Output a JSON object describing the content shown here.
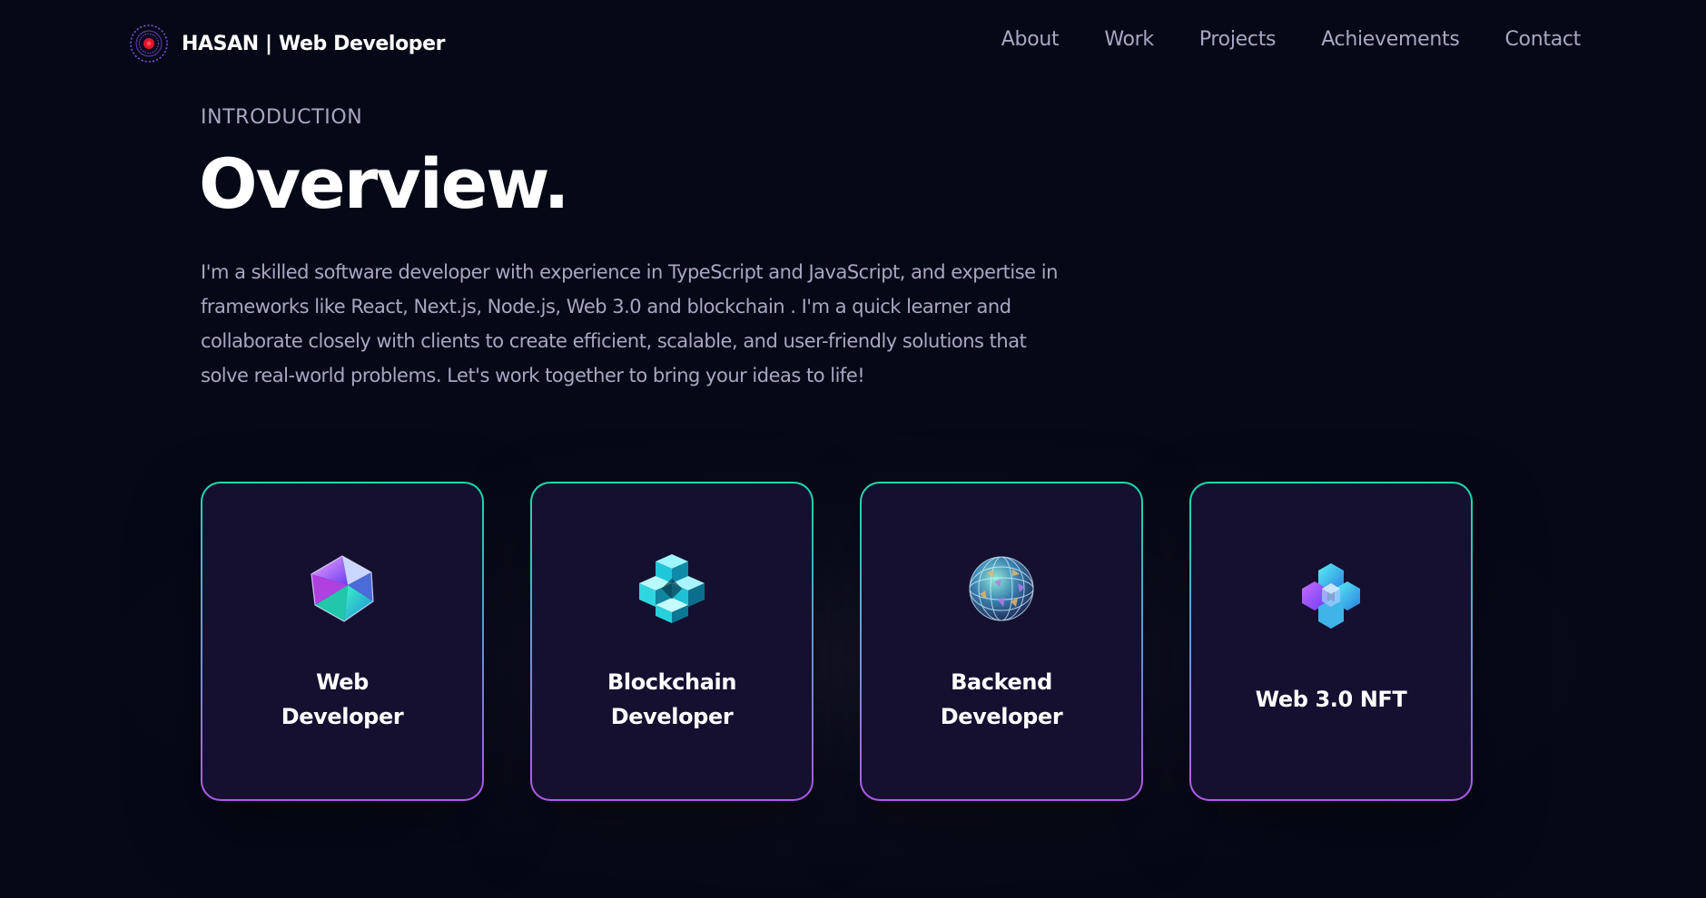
{
  "navbar": {
    "brand": "HASAN  | Web Developer",
    "links": [
      "About",
      "Work",
      "Projects",
      "Achievements",
      "Contact"
    ]
  },
  "intro": {
    "subtitle": "Introduction",
    "title": "Overview.",
    "paragraph": "I'm a skilled software developer with experience in TypeScript and JavaScript, and expertise in frameworks like React, Next.js, Node.js, Web 3.0 and blockchain . I'm a quick learner and collaborate closely with clients to create efficient, scalable, and user-friendly solutions that solve real-world problems. Let's work together to bring your ideas to life!"
  },
  "services": [
    {
      "title": "Web Developer",
      "icon": "icosahedron-gem-icon"
    },
    {
      "title": "Blockchain Developer",
      "icon": "cube-lattice-icon"
    },
    {
      "title": "Backend Developer",
      "icon": "faceted-sphere-icon"
    },
    {
      "title": "Web 3.0 NFT",
      "icon": "hexagon-cluster-icon"
    }
  ],
  "colors": {
    "background": "#050816",
    "secondary_text": "#aaa6c3",
    "card_background": "#151030",
    "card_border_top": "#1ed9a8",
    "card_border_bottom": "#b257e8",
    "logo_accent": "#e0142c"
  }
}
